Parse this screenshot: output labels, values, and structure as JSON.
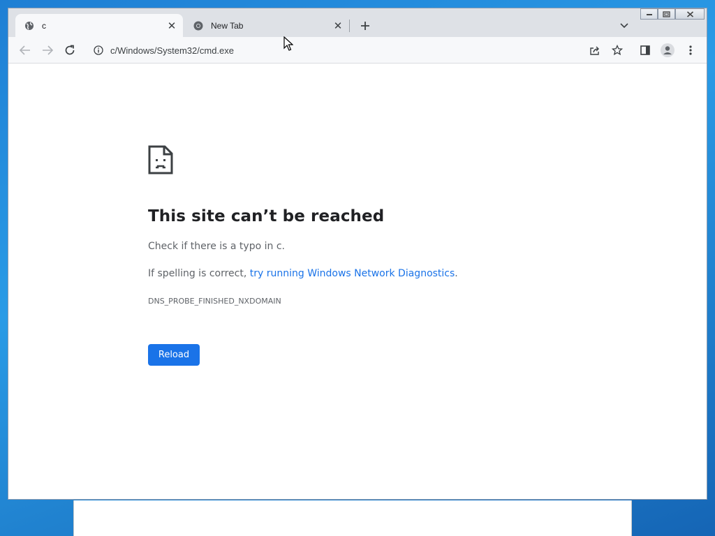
{
  "tabs": [
    {
      "title": "c",
      "favicon": "globe-icon",
      "active": true
    },
    {
      "title": "New Tab",
      "favicon": "chrome-icon",
      "active": false
    }
  ],
  "toolbar": {
    "url": "c/Windows/System32/cmd.exe"
  },
  "error_page": {
    "icon": "sad-page-icon",
    "heading": "This site can’t be reached",
    "line1": "Check if there is a typo in c.",
    "line2_prefix": "If spelling is correct, ",
    "line2_link": "try running Windows Network Diagnostics",
    "line2_suffix": ".",
    "error_code": "DNS_PROBE_FINISHED_NXDOMAIN",
    "reload_label": "Reload"
  },
  "colors": {
    "accent": "#1a73e8",
    "desktop": "#2a9be6",
    "tabstrip": "#dee1e6"
  }
}
